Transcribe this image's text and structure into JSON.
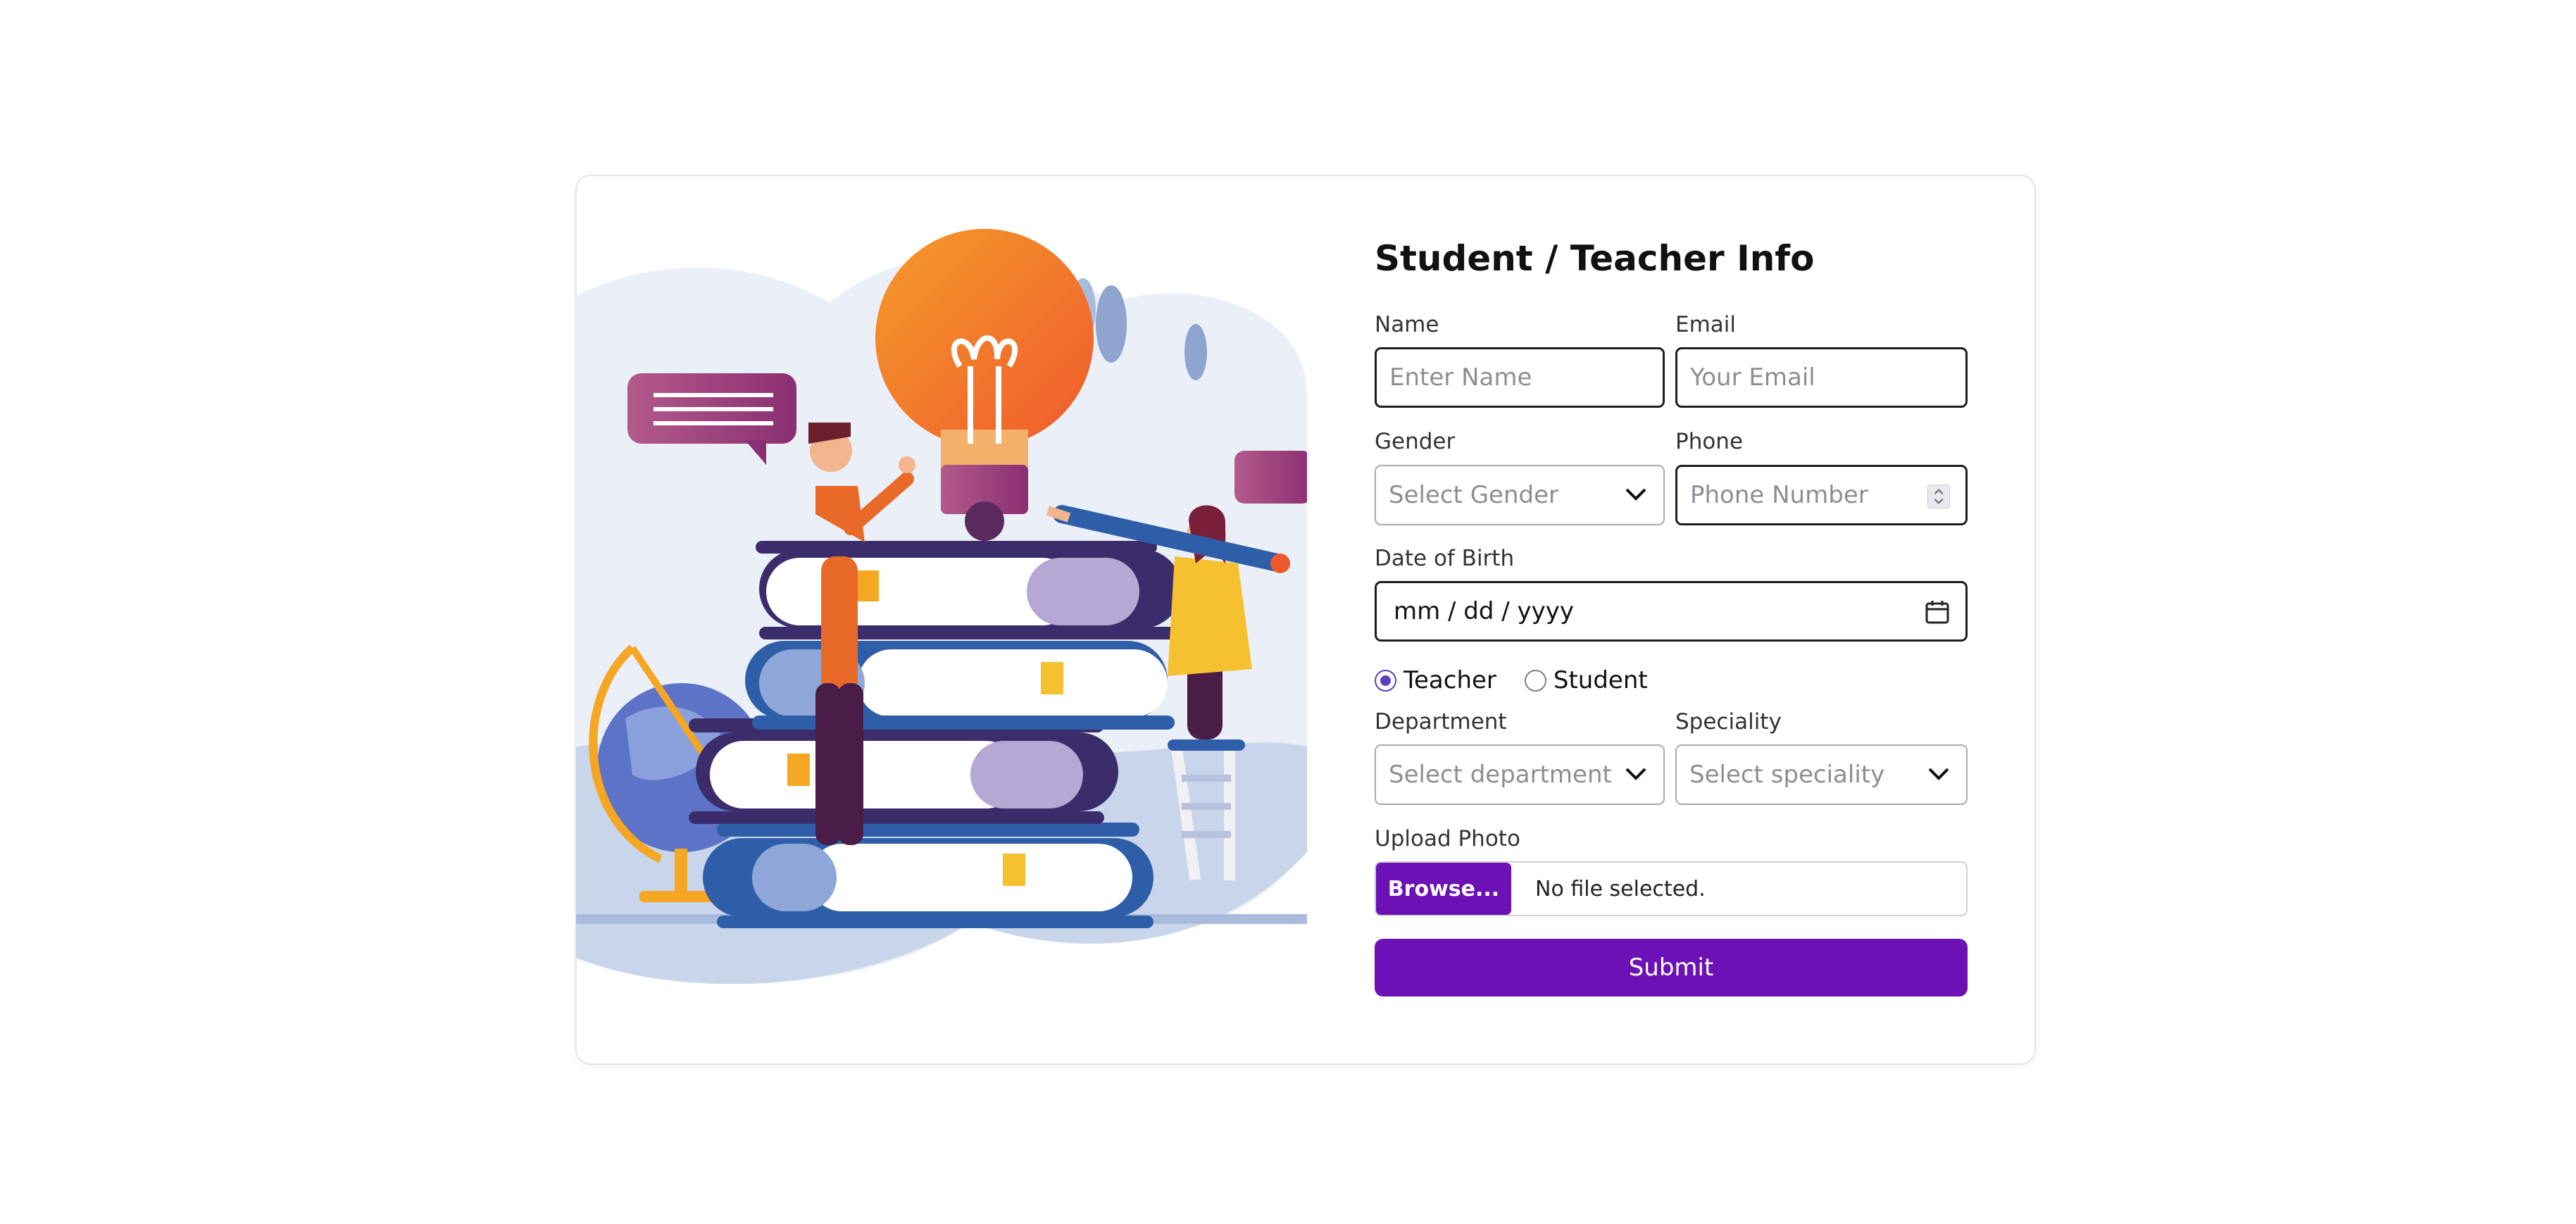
{
  "form": {
    "title": "Student / Teacher Info",
    "name": {
      "label": "Name",
      "placeholder": "Enter Name"
    },
    "email": {
      "label": "Email",
      "placeholder": "Your Email"
    },
    "gender": {
      "label": "Gender",
      "placeholder": "Select Gender"
    },
    "phone": {
      "label": "Phone",
      "placeholder": "Phone Number"
    },
    "dob": {
      "label": "Date of Birth",
      "value": "mm / dd / yyyy"
    },
    "role": {
      "options": [
        {
          "label": "Teacher",
          "checked": true
        },
        {
          "label": "Student",
          "checked": false
        }
      ]
    },
    "department": {
      "label": "Department",
      "placeholder": "Select department"
    },
    "speciality": {
      "label": "Speciality",
      "placeholder": "Select speciality"
    },
    "upload": {
      "label": "Upload Photo",
      "button": "Browse...",
      "status": "No file selected."
    },
    "submit": "Submit"
  },
  "icons": {
    "gender_select": "chevron-down-icon",
    "department_select": "chevron-down-icon",
    "speciality_select": "chevron-down-icon",
    "dob": "calendar-icon",
    "phone": "spinner-icon"
  },
  "colors": {
    "accent": "#6b11b5",
    "radio_selected": "#5a3fbf",
    "border": "#1d1d1d"
  }
}
